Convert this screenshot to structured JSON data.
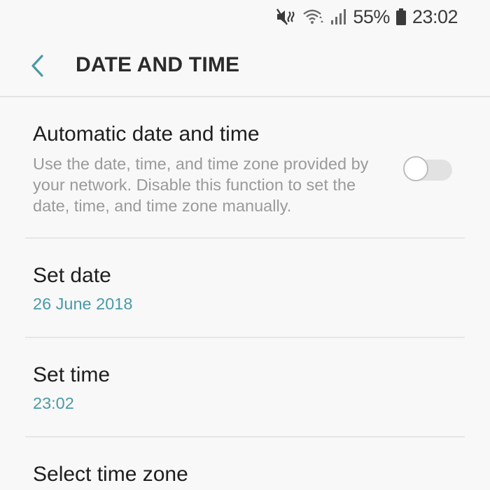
{
  "status_bar": {
    "battery_percent": "55%",
    "time": "23:02",
    "icons": [
      "mute-vibrate-icon",
      "wifi-icon",
      "signal-icon",
      "battery-icon"
    ]
  },
  "header": {
    "title": "DATE AND TIME",
    "back_icon": "chevron-left-icon"
  },
  "settings": {
    "automatic": {
      "title": "Automatic date and time",
      "description": "Use the date, time, and time zone provided by your network. Disable this function to set the date, time, and time zone manually.",
      "enabled": false
    },
    "set_date": {
      "title": "Set date",
      "value": "26 June 2018"
    },
    "set_time": {
      "title": "Set time",
      "value": "23:02"
    },
    "time_zone": {
      "title": "Select time zone"
    }
  },
  "colors": {
    "accent": "#4a9aa6",
    "background": "#f8f8f8",
    "secondary_text": "#9a9a9a"
  }
}
